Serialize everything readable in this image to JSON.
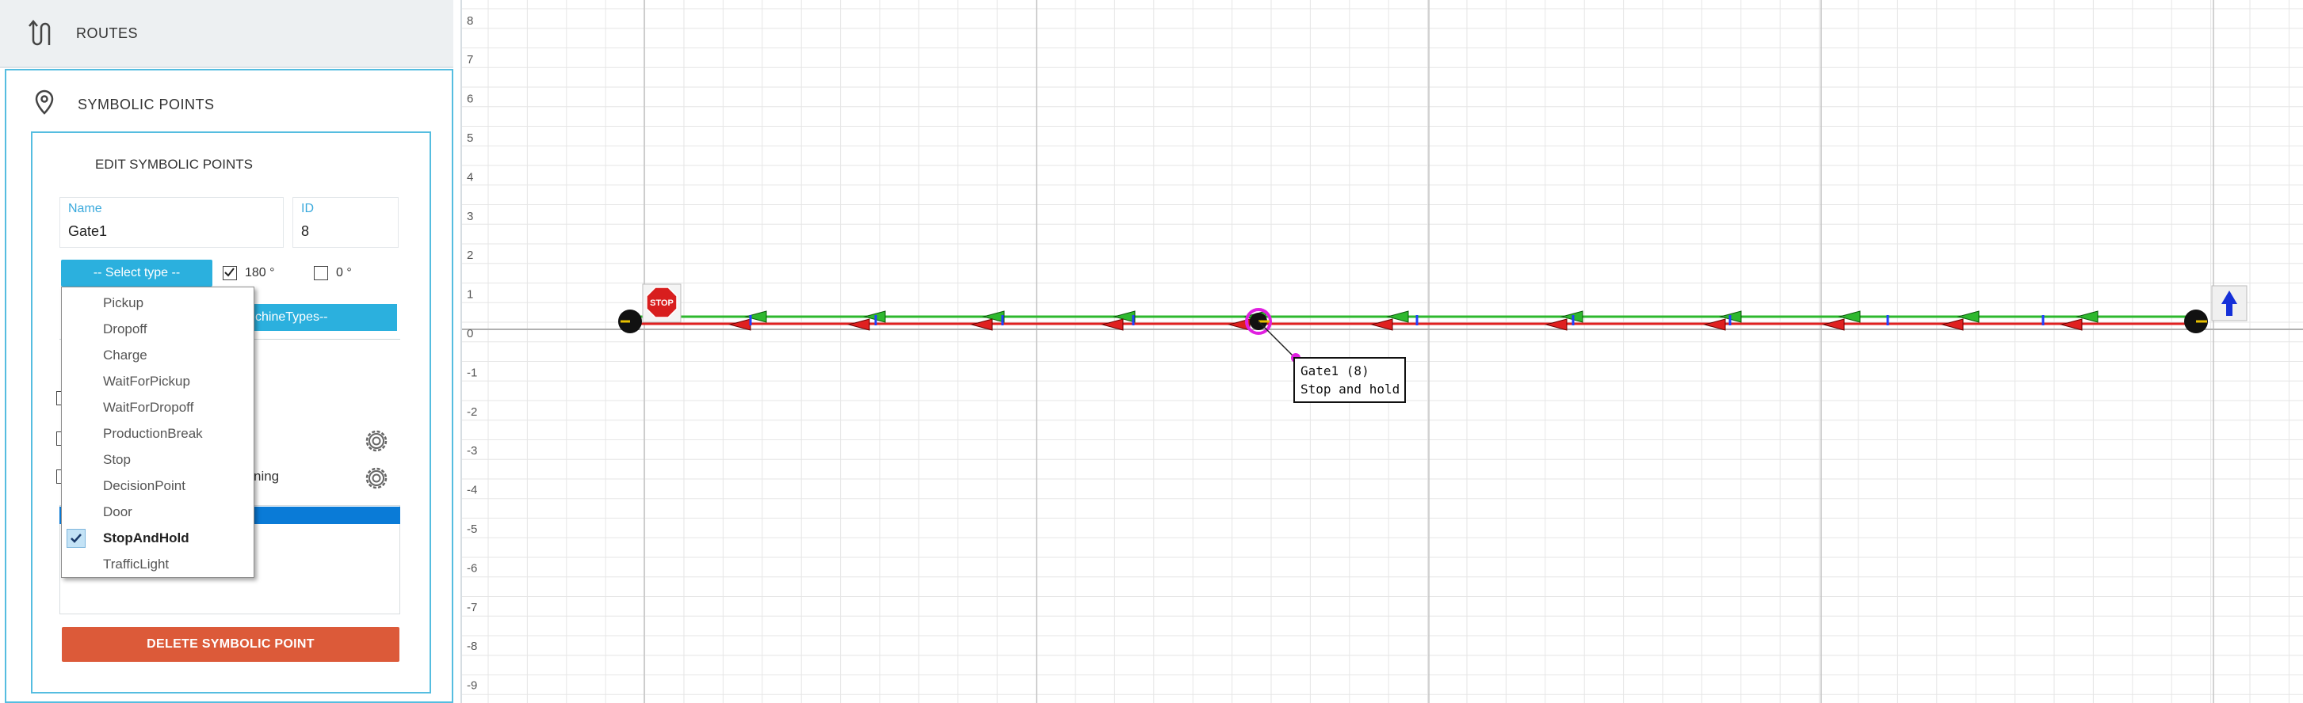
{
  "sidebar": {
    "routes_label": "ROUTES",
    "symbolic_points_label": "SYMBOLIC POINTS",
    "edit_title": "EDIT SYMBOLIC POINTS",
    "name_label": "Name",
    "name_value": "Gate1",
    "id_label": "ID",
    "id_value": "8",
    "type_select": "-- Select type --",
    "angle_180_label": "180 °",
    "angle_0_label": "0 °",
    "machine_types_label": "chineTypes--",
    "partial_label": "ning",
    "delete_label": "DELETE SYMBOLIC POINT"
  },
  "dropdown": {
    "items": [
      {
        "label": "Pickup",
        "selected": false
      },
      {
        "label": "Dropoff",
        "selected": false
      },
      {
        "label": "Charge",
        "selected": false
      },
      {
        "label": "WaitForPickup",
        "selected": false
      },
      {
        "label": "WaitForDropoff",
        "selected": false
      },
      {
        "label": "ProductionBreak",
        "selected": false
      },
      {
        "label": "Stop",
        "selected": false
      },
      {
        "label": "DecisionPoint",
        "selected": false
      },
      {
        "label": "Door",
        "selected": false
      },
      {
        "label": "StopAndHold",
        "selected": true
      },
      {
        "label": "TrafficLight",
        "selected": false
      }
    ]
  },
  "canvas": {
    "y_labels": [
      "8",
      "7",
      "6",
      "5",
      "4",
      "3",
      "2",
      "1",
      "0",
      "-1",
      "-2",
      "-3",
      "-4",
      "-5",
      "-6",
      "-7",
      "-8",
      "-9"
    ],
    "stop_sign_text": "STOP",
    "tooltip_line1": "Gate1 (8)",
    "tooltip_line2": "Stop and hold"
  },
  "colors": {
    "accent": "#2bb0de",
    "delete": "#dc5a39",
    "route_green": "#2eb82e",
    "route_red": "#e02020",
    "highlight": "#e020e0"
  }
}
